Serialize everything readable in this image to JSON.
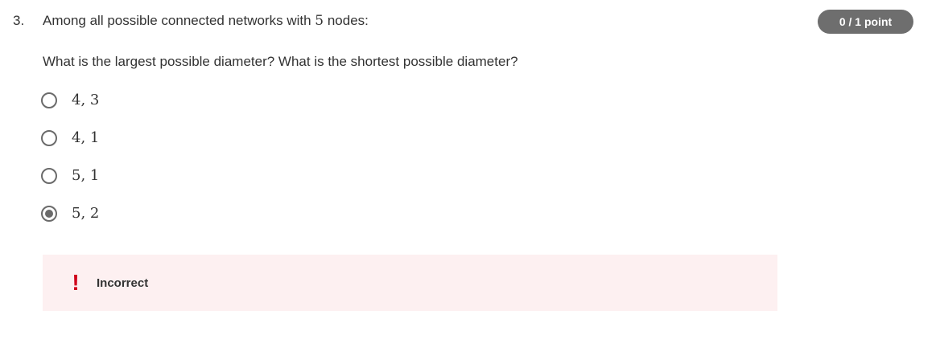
{
  "question": {
    "number": "3.",
    "prompt_before": "Among all possible connected networks with ",
    "prompt_math": "5",
    "prompt_after": " nodes:",
    "sub_prompt": "What is the largest possible diameter? What is the shortest possible diameter?",
    "points": "0 / 1 point"
  },
  "options": [
    {
      "label": "4, 3",
      "selected": false
    },
    {
      "label": "4, 1",
      "selected": false
    },
    {
      "label": "5, 1",
      "selected": false
    },
    {
      "label": "5, 2",
      "selected": true
    }
  ],
  "feedback": {
    "icon": "!",
    "icon_name": "exclamation-icon",
    "text": "Incorrect",
    "color": "#d0021b",
    "background": "#fdf0f1"
  }
}
